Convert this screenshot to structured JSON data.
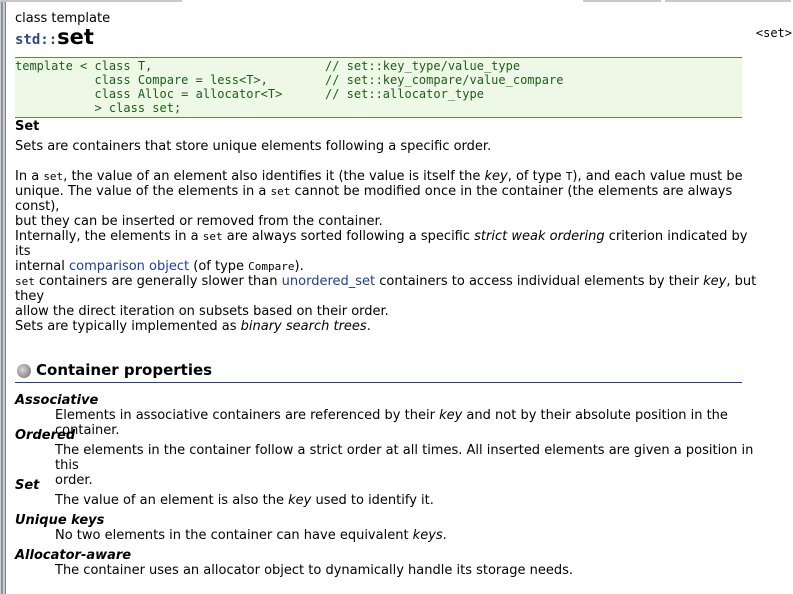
{
  "page": {
    "kind": "class template",
    "namespace": "std::",
    "name": "set",
    "header": "<set>"
  },
  "declaration": [
    {
      "code": "template < class T,",
      "comment": "// set::key_type/value_type"
    },
    {
      "code": "           class Compare = less<T>,",
      "comment": "// set::key_compare/value_compare"
    },
    {
      "code": "           class Alloc = allocator<T>",
      "comment": "// set::allocator_type"
    },
    {
      "code": "           > class set;",
      "comment": ""
    }
  ],
  "summary_title": "Set",
  "intro": "Sets are containers that store unique elements following a specific order.",
  "para2": {
    "t1": "In a ",
    "c1": "set",
    "t2": ", the value of an element also identifies it (the value is itself the ",
    "e1": "key",
    "t3": ", of type ",
    "c2": "T",
    "t4": "), and each value must be",
    "t5": "unique. The value of the elements in a ",
    "c3": "set",
    "t6": " cannot be modified once in the container (the elements are always const),",
    "t7": "but they can be inserted or removed from the container."
  },
  "para3": {
    "t1": "Internally, the elements in a ",
    "c1": "set",
    "t2": " are always sorted following a specific ",
    "e1": "strict weak ordering",
    "t3": " criterion indicated by its",
    "t4": "internal ",
    "link": "comparison object",
    "t5": " (of type ",
    "c2": "Compare",
    "t6": ")."
  },
  "para4": {
    "c1": "set",
    "t1": " containers are generally slower than ",
    "link": "unordered_set",
    "t2": " containers to access individual elements by their ",
    "e1": "key",
    "t3": ", but they",
    "t4": "allow the direct iteration on subsets based on their order."
  },
  "para5": {
    "t1": "Sets are typically implemented as ",
    "e1": "binary search trees",
    "t2": "."
  },
  "properties_heading": "Container properties",
  "properties": [
    {
      "name": "Associative",
      "d1": "Elements in associative containers are referenced by their ",
      "e": "key",
      "d2": " and not by their absolute position in the container."
    },
    {
      "name": "Ordered",
      "d1": "The elements in the container follow a strict order at all times. All inserted elements are given a position in this",
      "e": "",
      "d2": "",
      "line2": "order."
    },
    {
      "name": "Set",
      "d1": "The value of an element is also the ",
      "e": "key",
      "d2": " used to identify it."
    },
    {
      "name": "Unique keys",
      "d1": "No two elements in the container can have equivalent ",
      "e": "keys",
      "d2": "."
    },
    {
      "name": "Allocator-aware",
      "d1": "The container uses an allocator object to dynamically handle its storage needs.",
      "e": "",
      "d2": ""
    }
  ],
  "colors": {
    "code_text": "#1d5d18",
    "code_bg": "#eef8e6",
    "link": "#1d3d9c",
    "namespace": "#2c4a84"
  }
}
